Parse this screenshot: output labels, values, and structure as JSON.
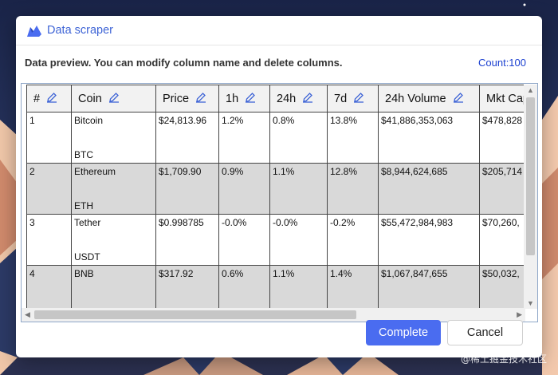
{
  "dialog": {
    "title": "Data scraper",
    "info": "Data preview. You can modify column name and delete columns.",
    "count": "Count:100"
  },
  "table": {
    "columns": [
      "#",
      "Coin",
      "Price",
      "1h",
      "24h",
      "7d",
      "24h Volume",
      "Mkt Cap"
    ],
    "rows": [
      {
        "num": "1",
        "coin": "Bitcoin",
        "symbol": "BTC",
        "price": "$24,813.96",
        "h1": "1.2%",
        "h24": "0.8%",
        "d7": "13.8%",
        "volume": "$41,886,353,063",
        "mcap": "$478,828"
      },
      {
        "num": "2",
        "coin": "Ethereum",
        "symbol": "ETH",
        "price": "$1,709.90",
        "h1": "0.9%",
        "h24": "1.1%",
        "d7": "12.8%",
        "volume": "$8,944,624,685",
        "mcap": "$205,714"
      },
      {
        "num": "3",
        "coin": "Tether",
        "symbol": "USDT",
        "price": "$0.998785",
        "h1": "-0.0%",
        "h24": "-0.0%",
        "d7": "-0.2%",
        "volume": "$55,472,984,983",
        "mcap": "$70,260,"
      },
      {
        "num": "4",
        "coin": "BNB",
        "symbol": "",
        "price": "$317.92",
        "h1": "0.6%",
        "h24": "1.1%",
        "d7": "1.4%",
        "volume": "$1,067,847,655",
        "mcap": "$50,032,"
      }
    ]
  },
  "buttons": {
    "complete": "Complete",
    "cancel": "Cancel"
  },
  "watermark": "@稀土掘金技术社区",
  "colors": {
    "accent": "#4a6cf0",
    "title": "#3e64d6",
    "count": "#1a3fd0",
    "row_alt": "#d9d9d9"
  }
}
